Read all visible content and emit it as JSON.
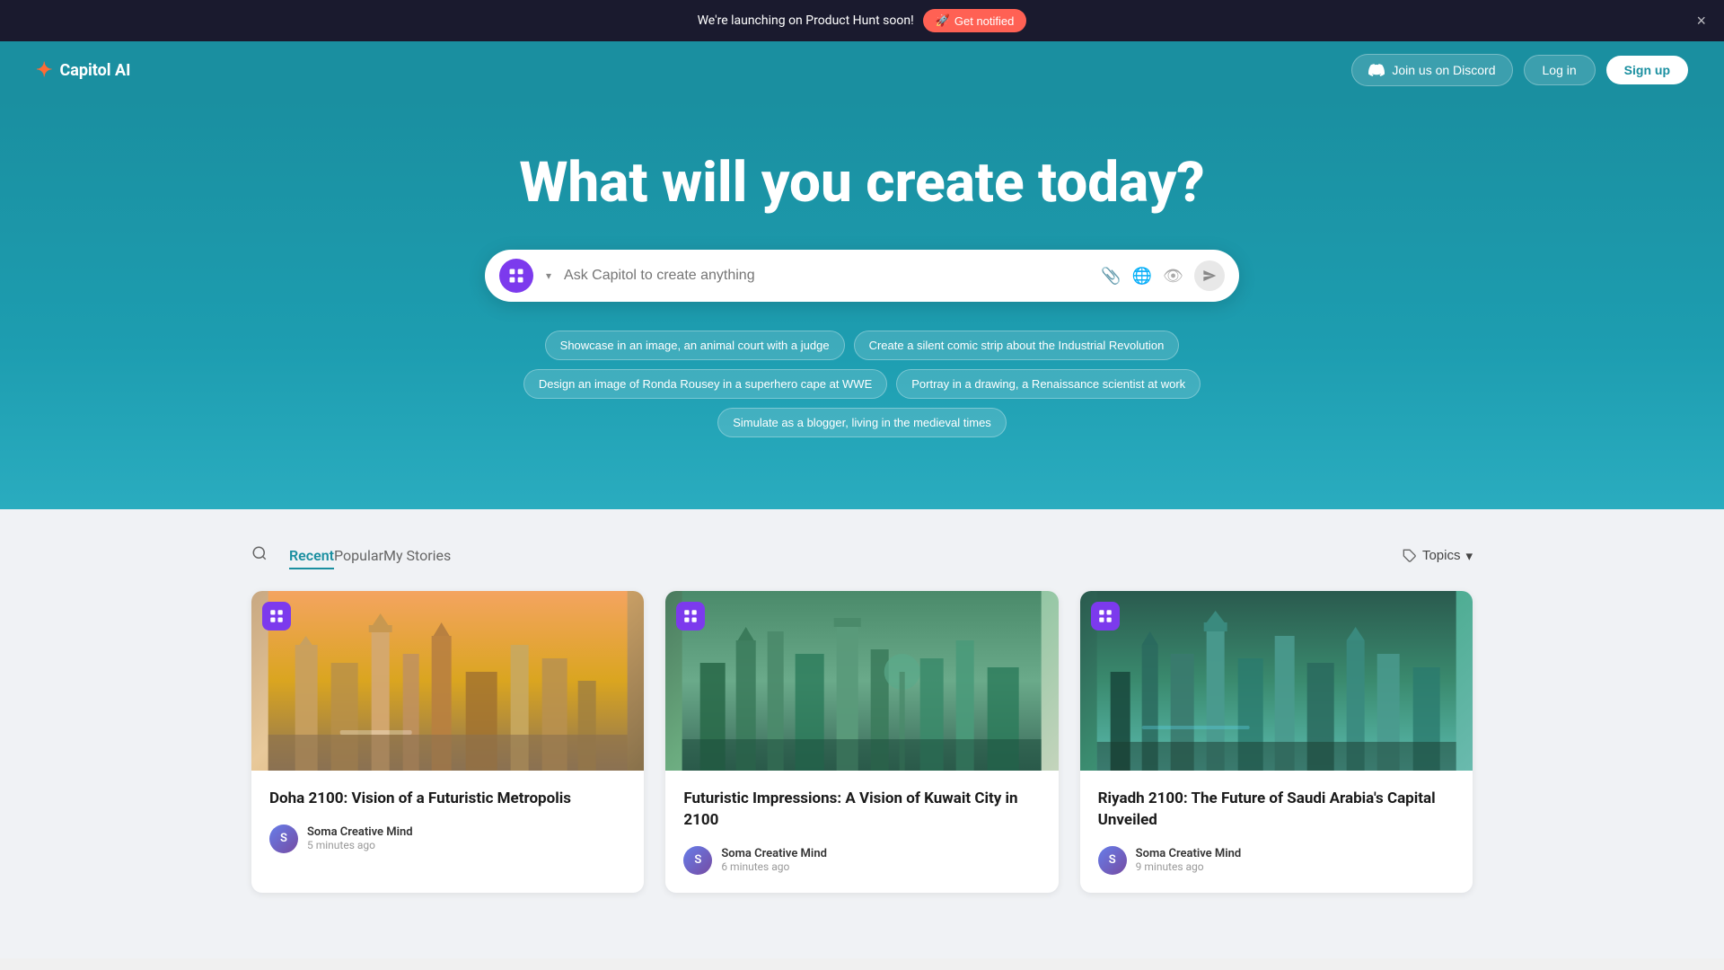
{
  "announcement": {
    "text": "We're launching on Product Hunt soon!",
    "cta_label": "Get notified",
    "close_label": "×",
    "rocket_emoji": "🚀"
  },
  "header": {
    "logo_text": "Capitol AI",
    "logo_star": "✦",
    "discord_label": "Join us on Discord",
    "login_label": "Log in",
    "signup_label": "Sign up"
  },
  "hero": {
    "title": "What will you create today?",
    "search_placeholder": "Ask Capitol to create anything"
  },
  "suggestions": [
    {
      "text": "Showcase in an image, an animal court with a judge"
    },
    {
      "text": "Create a silent comic strip about the Industrial Revolution"
    },
    {
      "text": "Design an image of Ronda Rousey in a superhero cape at WWE"
    },
    {
      "text": "Portray in a drawing, a Renaissance scientist at work"
    },
    {
      "text": "Simulate as a blogger, living in the medieval times"
    }
  ],
  "tabs": {
    "items": [
      {
        "label": "Recent",
        "active": true
      },
      {
        "label": "Popular",
        "active": false
      },
      {
        "label": "My Stories",
        "active": false
      }
    ],
    "topics_label": "Topics"
  },
  "cards": [
    {
      "title": "Doha 2100: Vision of a Futuristic Metropolis",
      "author": "Soma Creative Mind",
      "time": "5 minutes ago",
      "img_type": "doha"
    },
    {
      "title": "Futuristic Impressions: A Vision of Kuwait City in 2100",
      "author": "Soma Creative Mind",
      "time": "6 minutes ago",
      "img_type": "kuwait"
    },
    {
      "title": "Riyadh 2100: The Future of Saudi Arabia's Capital Unveiled",
      "author": "Soma Creative Mind",
      "time": "9 minutes ago",
      "img_type": "riyadh"
    }
  ]
}
